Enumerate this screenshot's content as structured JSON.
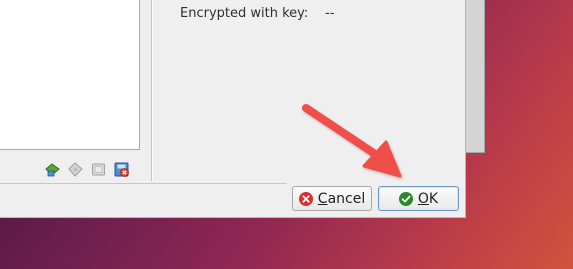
{
  "info": {
    "encrypted_label": "Encrypted with key:",
    "encrypted_value": "--"
  },
  "toolbar": {
    "buttons": [
      {
        "icon": "add-controller-icon"
      },
      {
        "icon": "add-attachment-icon"
      },
      {
        "icon": "remove-attachment-icon"
      },
      {
        "icon": "remove-controller-icon"
      }
    ]
  },
  "buttons": {
    "cancel_mnemonic": "C",
    "cancel_rest": "ancel",
    "ok_mnemonic": "O",
    "ok_rest": "K"
  },
  "colors": {
    "cancel_icon": "#d8302f",
    "ok_icon": "#2a8a2a",
    "annotation_arrow": "#f0504a",
    "focus_border": "#6d97c5"
  }
}
